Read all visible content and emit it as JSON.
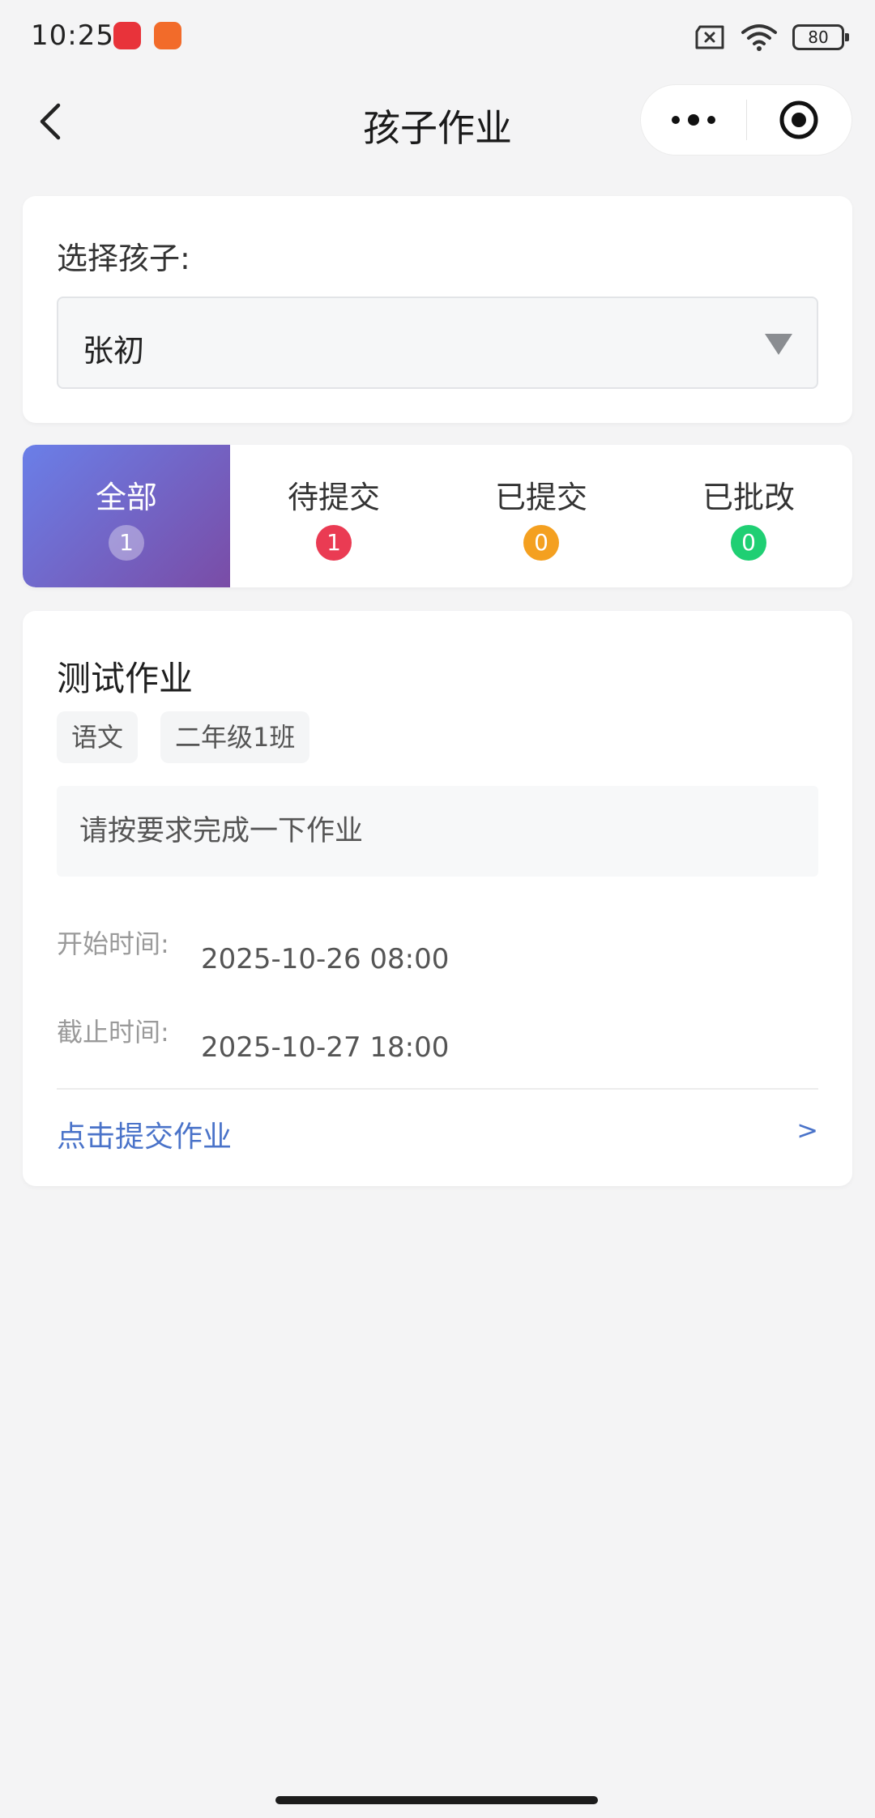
{
  "status_bar": {
    "time": "10:25",
    "battery": "80",
    "icons": [
      "app-red-icon",
      "app-orange-icon",
      "sim-x-icon",
      "wifi-icon",
      "battery-icon"
    ]
  },
  "nav": {
    "title": "孩子作业",
    "back_icon": "chevron-left-icon",
    "more_icon": "more-dots-icon",
    "close_icon": "target-close-icon"
  },
  "child_selector": {
    "label": "选择孩子:",
    "selected": "张初"
  },
  "tabs": [
    {
      "label": "全部",
      "count": "1",
      "active": true,
      "badge_color": "#ffffff"
    },
    {
      "label": "待提交",
      "count": "1",
      "active": false,
      "badge_color": "#ea3b53"
    },
    {
      "label": "已提交",
      "count": "0",
      "active": false,
      "badge_color": "#f4a020"
    },
    {
      "label": "已批改",
      "count": "0",
      "active": false,
      "badge_color": "#1fcf73"
    }
  ],
  "homework": {
    "title": "测试作业",
    "tags": [
      "语文",
      "二年级1班"
    ],
    "description": "请按要求完成一下作业",
    "start_label": "开始时间:",
    "start_value": "2025-10-26 08:00",
    "end_label": "截止时间:",
    "end_value": "2025-10-27 18:00",
    "submit_label": "点击提交作业",
    "submit_chevron": ">"
  },
  "colors": {
    "accent_gradient_start": "#6a7fe8",
    "accent_gradient_end": "#7a4ca6",
    "link": "#4a73c9"
  }
}
